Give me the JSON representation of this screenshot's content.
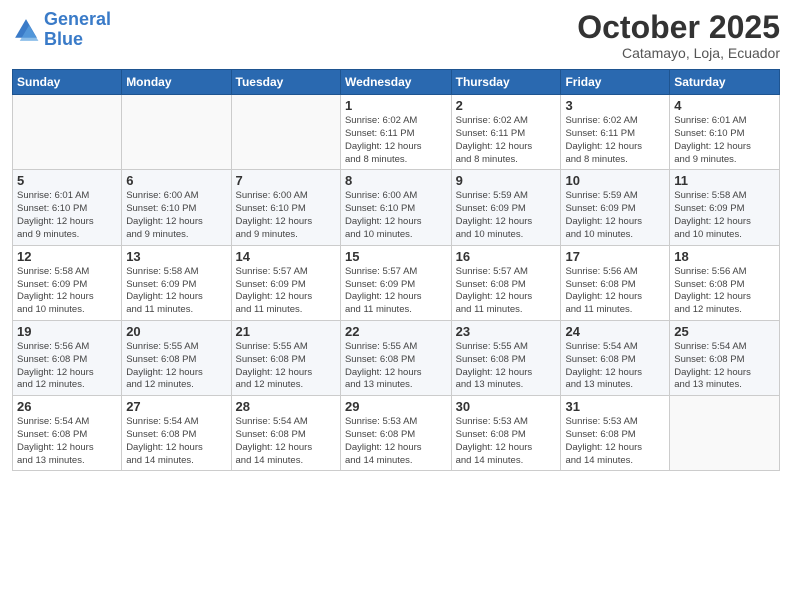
{
  "header": {
    "logo_line1": "General",
    "logo_line2": "Blue",
    "month": "October 2025",
    "location": "Catamayo, Loja, Ecuador"
  },
  "weekdays": [
    "Sunday",
    "Monday",
    "Tuesday",
    "Wednesday",
    "Thursday",
    "Friday",
    "Saturday"
  ],
  "weeks": [
    [
      {
        "day": "",
        "info": ""
      },
      {
        "day": "",
        "info": ""
      },
      {
        "day": "",
        "info": ""
      },
      {
        "day": "1",
        "info": "Sunrise: 6:02 AM\nSunset: 6:11 PM\nDaylight: 12 hours\nand 8 minutes."
      },
      {
        "day": "2",
        "info": "Sunrise: 6:02 AM\nSunset: 6:11 PM\nDaylight: 12 hours\nand 8 minutes."
      },
      {
        "day": "3",
        "info": "Sunrise: 6:02 AM\nSunset: 6:11 PM\nDaylight: 12 hours\nand 8 minutes."
      },
      {
        "day": "4",
        "info": "Sunrise: 6:01 AM\nSunset: 6:10 PM\nDaylight: 12 hours\nand 9 minutes."
      }
    ],
    [
      {
        "day": "5",
        "info": "Sunrise: 6:01 AM\nSunset: 6:10 PM\nDaylight: 12 hours\nand 9 minutes."
      },
      {
        "day": "6",
        "info": "Sunrise: 6:00 AM\nSunset: 6:10 PM\nDaylight: 12 hours\nand 9 minutes."
      },
      {
        "day": "7",
        "info": "Sunrise: 6:00 AM\nSunset: 6:10 PM\nDaylight: 12 hours\nand 9 minutes."
      },
      {
        "day": "8",
        "info": "Sunrise: 6:00 AM\nSunset: 6:10 PM\nDaylight: 12 hours\nand 10 minutes."
      },
      {
        "day": "9",
        "info": "Sunrise: 5:59 AM\nSunset: 6:09 PM\nDaylight: 12 hours\nand 10 minutes."
      },
      {
        "day": "10",
        "info": "Sunrise: 5:59 AM\nSunset: 6:09 PM\nDaylight: 12 hours\nand 10 minutes."
      },
      {
        "day": "11",
        "info": "Sunrise: 5:58 AM\nSunset: 6:09 PM\nDaylight: 12 hours\nand 10 minutes."
      }
    ],
    [
      {
        "day": "12",
        "info": "Sunrise: 5:58 AM\nSunset: 6:09 PM\nDaylight: 12 hours\nand 10 minutes."
      },
      {
        "day": "13",
        "info": "Sunrise: 5:58 AM\nSunset: 6:09 PM\nDaylight: 12 hours\nand 11 minutes."
      },
      {
        "day": "14",
        "info": "Sunrise: 5:57 AM\nSunset: 6:09 PM\nDaylight: 12 hours\nand 11 minutes."
      },
      {
        "day": "15",
        "info": "Sunrise: 5:57 AM\nSunset: 6:09 PM\nDaylight: 12 hours\nand 11 minutes."
      },
      {
        "day": "16",
        "info": "Sunrise: 5:57 AM\nSunset: 6:08 PM\nDaylight: 12 hours\nand 11 minutes."
      },
      {
        "day": "17",
        "info": "Sunrise: 5:56 AM\nSunset: 6:08 PM\nDaylight: 12 hours\nand 11 minutes."
      },
      {
        "day": "18",
        "info": "Sunrise: 5:56 AM\nSunset: 6:08 PM\nDaylight: 12 hours\nand 12 minutes."
      }
    ],
    [
      {
        "day": "19",
        "info": "Sunrise: 5:56 AM\nSunset: 6:08 PM\nDaylight: 12 hours\nand 12 minutes."
      },
      {
        "day": "20",
        "info": "Sunrise: 5:55 AM\nSunset: 6:08 PM\nDaylight: 12 hours\nand 12 minutes."
      },
      {
        "day": "21",
        "info": "Sunrise: 5:55 AM\nSunset: 6:08 PM\nDaylight: 12 hours\nand 12 minutes."
      },
      {
        "day": "22",
        "info": "Sunrise: 5:55 AM\nSunset: 6:08 PM\nDaylight: 12 hours\nand 13 minutes."
      },
      {
        "day": "23",
        "info": "Sunrise: 5:55 AM\nSunset: 6:08 PM\nDaylight: 12 hours\nand 13 minutes."
      },
      {
        "day": "24",
        "info": "Sunrise: 5:54 AM\nSunset: 6:08 PM\nDaylight: 12 hours\nand 13 minutes."
      },
      {
        "day": "25",
        "info": "Sunrise: 5:54 AM\nSunset: 6:08 PM\nDaylight: 12 hours\nand 13 minutes."
      }
    ],
    [
      {
        "day": "26",
        "info": "Sunrise: 5:54 AM\nSunset: 6:08 PM\nDaylight: 12 hours\nand 13 minutes."
      },
      {
        "day": "27",
        "info": "Sunrise: 5:54 AM\nSunset: 6:08 PM\nDaylight: 12 hours\nand 14 minutes."
      },
      {
        "day": "28",
        "info": "Sunrise: 5:54 AM\nSunset: 6:08 PM\nDaylight: 12 hours\nand 14 minutes."
      },
      {
        "day": "29",
        "info": "Sunrise: 5:53 AM\nSunset: 6:08 PM\nDaylight: 12 hours\nand 14 minutes."
      },
      {
        "day": "30",
        "info": "Sunrise: 5:53 AM\nSunset: 6:08 PM\nDaylight: 12 hours\nand 14 minutes."
      },
      {
        "day": "31",
        "info": "Sunrise: 5:53 AM\nSunset: 6:08 PM\nDaylight: 12 hours\nand 14 minutes."
      },
      {
        "day": "",
        "info": ""
      }
    ]
  ]
}
